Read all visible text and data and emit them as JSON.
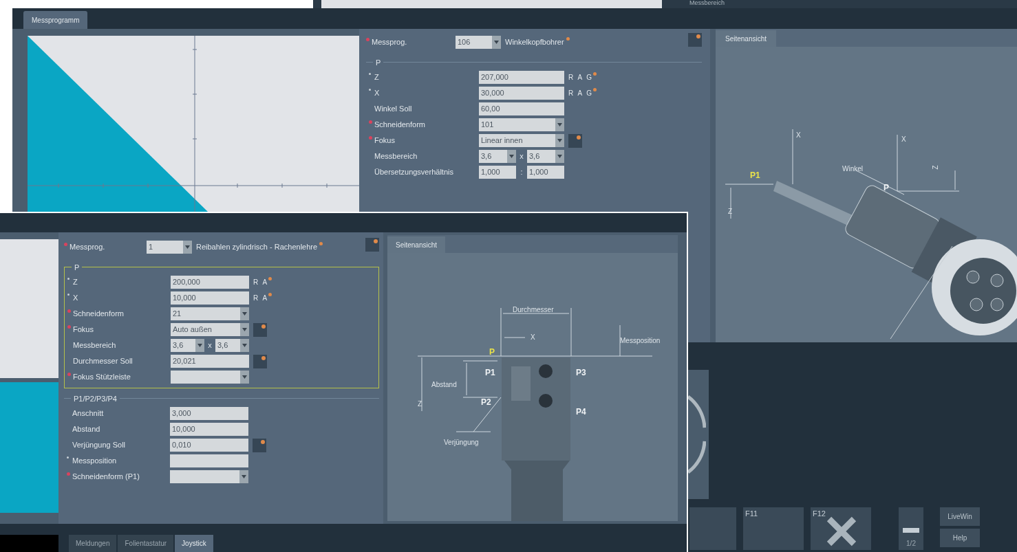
{
  "top_window": {
    "label": "Messbereich"
  },
  "back_window": {
    "tab": "Messprogramm",
    "form": {
      "program": {
        "label": "Messprog.",
        "required": true,
        "value": "106",
        "name": "Winkelkopfbohrer",
        "button": true
      },
      "groups": [
        {
          "title": "P",
          "framed": false,
          "rows": [
            {
              "label": "Z",
              "required": false,
              "starred": true,
              "kind": "input",
              "value": "207,000",
              "suffix": "R A G"
            },
            {
              "label": "X",
              "required": false,
              "starred": true,
              "kind": "input",
              "value": "30,000",
              "suffix": "R A G"
            },
            {
              "label": "Winkel Soll",
              "required": false,
              "starred": false,
              "kind": "input",
              "value": "60,00"
            },
            {
              "label": "Schneidenform",
              "required": true,
              "kind": "select",
              "value": "101"
            },
            {
              "label": "Fokus",
              "required": true,
              "kind": "select",
              "value": "Linear innen",
              "button": true
            },
            {
              "label": "Messbereich",
              "required": false,
              "starred": false,
              "kind": "pair-select",
              "values": [
                "3,6",
                "3,6"
              ],
              "separator": "x"
            },
            {
              "label": "Übersetzungsverhältnis",
              "required": false,
              "starred": false,
              "kind": "pair-input",
              "values": [
                "1,000",
                "1,000"
              ],
              "separator": ":"
            }
          ]
        }
      ]
    },
    "side_view": {
      "tab": "Seitenansicht",
      "labels": [
        {
          "text": "X",
          "kind": "dimension"
        },
        {
          "text": "X",
          "kind": "dimension"
        },
        {
          "text": "Winkel",
          "kind": "dimension"
        },
        {
          "text": "P1",
          "kind": "highlight"
        },
        {
          "text": "P",
          "kind": "point"
        },
        {
          "text": "Z",
          "kind": "dimension"
        },
        {
          "text": "Z",
          "kind": "dimension"
        }
      ]
    },
    "function_keys": [
      {
        "kind": "blank"
      },
      {
        "kind": "blank",
        "label": "F11"
      },
      {
        "kind": "close",
        "label": "F12"
      }
    ],
    "page_indicator": "1/2",
    "buttons": [
      "LiveWin",
      "Help"
    ]
  },
  "front_window": {
    "form": {
      "program": {
        "label": "Messprog.",
        "required": true,
        "value": "1",
        "name": "Reibahlen zylindrisch - Rachenlehre",
        "button": true
      },
      "groups": [
        {
          "title": "P",
          "framed": true,
          "rows": [
            {
              "label": "Z",
              "required": false,
              "starred": true,
              "kind": "input",
              "value": "200,000",
              "suffix": "R A"
            },
            {
              "label": "X",
              "required": false,
              "starred": true,
              "kind": "input",
              "value": "10,000",
              "suffix": "R A"
            },
            {
              "label": "Schneidenform",
              "required": true,
              "kind": "select",
              "value": "21"
            },
            {
              "label": "Fokus",
              "required": true,
              "kind": "select",
              "value": "Auto außen",
              "button": true
            },
            {
              "label": "Messbereich",
              "required": false,
              "starred": false,
              "kind": "pair-select",
              "values": [
                "3,6",
                "3,6"
              ],
              "separator": "x"
            },
            {
              "label": "Durchmesser Soll",
              "required": false,
              "starred": false,
              "kind": "input",
              "value": "20,021",
              "button": true
            },
            {
              "label": "Fokus Stützleiste",
              "required": true,
              "kind": "select"
            }
          ]
        },
        {
          "title": "P1/P2/P3/P4",
          "framed": false,
          "rows": [
            {
              "label": "Anschnitt",
              "required": false,
              "starred": false,
              "kind": "input",
              "value": "3,000"
            },
            {
              "label": "Abstand",
              "required": false,
              "starred": false,
              "kind": "input",
              "value": "10,000"
            },
            {
              "label": "Verjüngung Soll",
              "required": false,
              "starred": false,
              "kind": "input",
              "value": "0,010",
              "button": true
            },
            {
              "label": "Messposition",
              "required": false,
              "starred": true,
              "kind": "input"
            },
            {
              "label": "Schneidenform (P1)",
              "required": true,
              "kind": "select"
            }
          ]
        }
      ]
    },
    "side_view": {
      "tab": "Seitenansicht",
      "labels": [
        {
          "text": "Durchmesser",
          "kind": "dimension"
        },
        {
          "text": "X",
          "kind": "dimension"
        },
        {
          "text": "Messposition",
          "kind": "dimension"
        },
        {
          "text": "P",
          "kind": "highlight"
        },
        {
          "text": "P1",
          "kind": "point"
        },
        {
          "text": "P3",
          "kind": "point"
        },
        {
          "text": "Abstand",
          "kind": "dimension"
        },
        {
          "text": "P2",
          "kind": "point"
        },
        {
          "text": "Z",
          "kind": "dimension"
        },
        {
          "text": "P4",
          "kind": "point"
        },
        {
          "text": "Verjüngung",
          "kind": "dimension"
        }
      ]
    },
    "bottom_tabs": [
      {
        "label": "Meldungen",
        "selected": false
      },
      {
        "label": "Folientastatur",
        "selected": false
      },
      {
        "label": "Joystick",
        "selected": true
      }
    ]
  }
}
